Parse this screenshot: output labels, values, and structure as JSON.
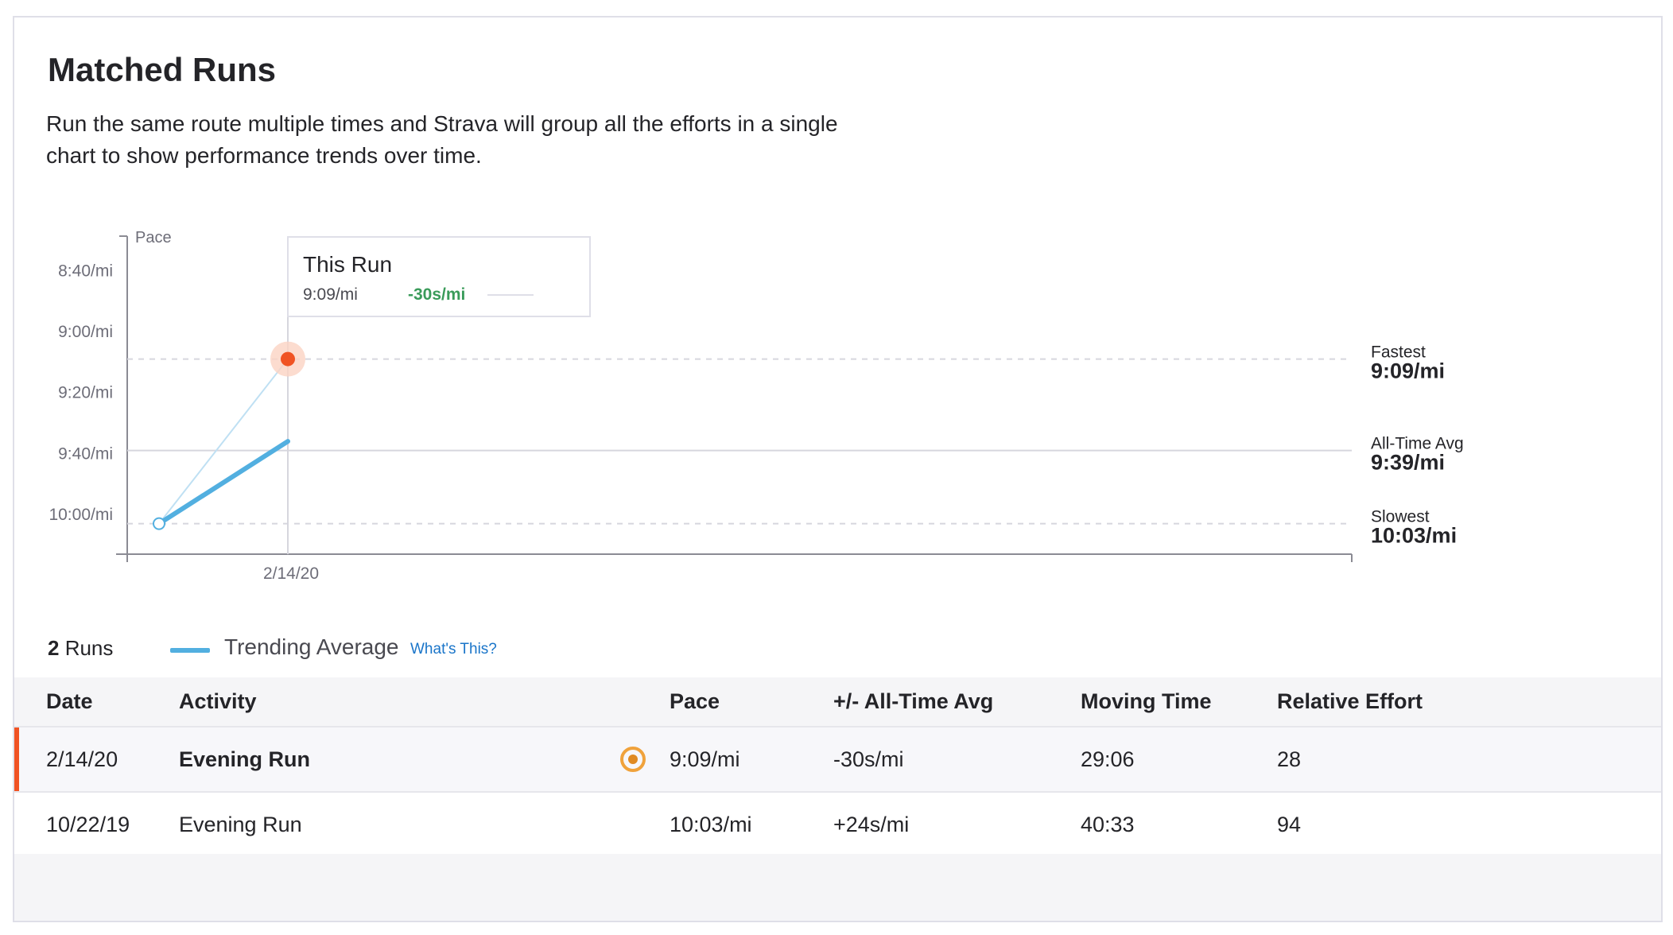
{
  "header": {
    "title": "Matched Runs",
    "description": "Run the same route multiple times and Strava will group all the efforts in a single chart to show performance trends over time."
  },
  "chart_data": {
    "type": "line",
    "ylabel": "Pace",
    "y_ticks": [
      "8:40/mi",
      "9:00/mi",
      "9:20/mi",
      "9:40/mi",
      "10:00/mi"
    ],
    "y_tick_seconds": [
      520,
      540,
      560,
      580,
      600
    ],
    "ylim_seconds": [
      510,
      613
    ],
    "x_ticks": [
      "2/14/20"
    ],
    "points": [
      {
        "label": "10/22/19",
        "pace": "10:03/mi",
        "pace_seconds": 603,
        "position": 0
      },
      {
        "label": "2/14/20",
        "pace": "9:09/mi",
        "pace_seconds": 549,
        "position": 1
      }
    ],
    "series": [
      {
        "name": "Trending Average",
        "pace_seconds": [
          603,
          576
        ]
      }
    ],
    "reference_lines": [
      {
        "name": "Fastest",
        "value": "9:09/mi",
        "pace_seconds": 549
      },
      {
        "name": "All-Time Avg",
        "value": "9:39/mi",
        "pace_seconds": 579
      },
      {
        "name": "Slowest",
        "value": "10:03/mi",
        "pace_seconds": 603
      }
    ],
    "colors": {
      "trend": "#52afe0",
      "current": "#f05323",
      "grid": "#d6d6de",
      "axis": "#8b8b94"
    }
  },
  "tooltip": {
    "title": "This Run",
    "pace": "9:09/mi",
    "diff": "-30s/mi"
  },
  "legend": {
    "runs_count": "2",
    "runs_label": " Runs",
    "trend_label": "Trending Average",
    "whats_this": "What's This?"
  },
  "table": {
    "headers": {
      "date": "Date",
      "activity": "Activity",
      "pace": "Pace",
      "diff": "+/- All-Time Avg",
      "moving": "Moving Time",
      "effort": "Relative Effort"
    },
    "rows": [
      {
        "date": "2/14/20",
        "activity": "Evening Run",
        "pace": "9:09/mi",
        "diff": "-30s/mi",
        "moving": "29:06",
        "effort": "28",
        "badge_icon": "target-icon"
      },
      {
        "date": "10/22/19",
        "activity": "Evening Run",
        "pace": "10:03/mi",
        "diff": "+24s/mi",
        "moving": "40:33",
        "effort": "94"
      }
    ]
  }
}
